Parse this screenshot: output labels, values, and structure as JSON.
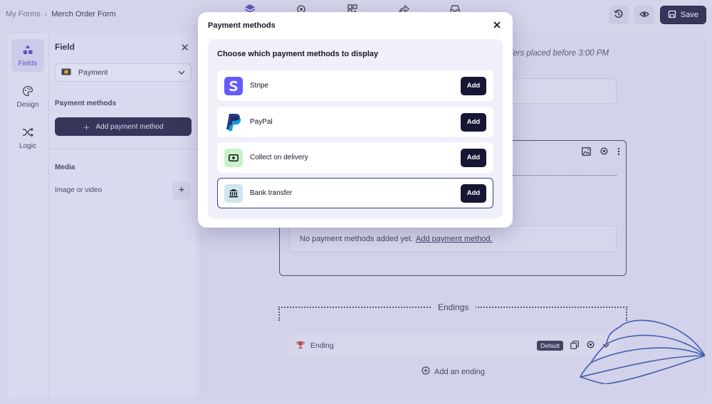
{
  "breadcrumb": {
    "root": "My Forms",
    "separator": "›",
    "current": "Merch Order Form"
  },
  "top_actions": {
    "save_label": "Save"
  },
  "rail": {
    "fields": "Fields",
    "design": "Design",
    "logic": "Logic"
  },
  "panel": {
    "title": "Field",
    "field_type": "Payment",
    "payment_methods_label": "Payment methods",
    "add_payment_method": "Add payment method",
    "media_label": "Media",
    "image_or_video": "Image or video"
  },
  "canvas": {
    "orders_note": "rders placed before 3:00 PM",
    "no_methods_text": "No payment methods added yet.",
    "no_methods_link": "Add payment method.",
    "endings_label": "Endings",
    "ending_name": "Ending",
    "ending_badge": "Default",
    "add_ending": "Add an ending"
  },
  "modal": {
    "title": "Payment methods",
    "subtitle": "Choose which payment methods to display",
    "methods": [
      {
        "name": "Stripe",
        "action": "Add",
        "icon": "stripe-icon",
        "icon_bg": "#635bff"
      },
      {
        "name": "PayPal",
        "action": "Add",
        "icon": "paypal-icon",
        "icon_bg": "#ffffff"
      },
      {
        "name": "Collect on delivery",
        "action": "Add",
        "icon": "cash-icon",
        "icon_bg": "#c9f2c9"
      },
      {
        "name": "Bank transfer",
        "action": "Add",
        "icon": "bank-icon",
        "icon_bg": "#cfe6ef",
        "selected": true
      }
    ]
  },
  "colors": {
    "accent": "#161735",
    "brand": "#4f46b8",
    "overlay": "#9696cd"
  }
}
